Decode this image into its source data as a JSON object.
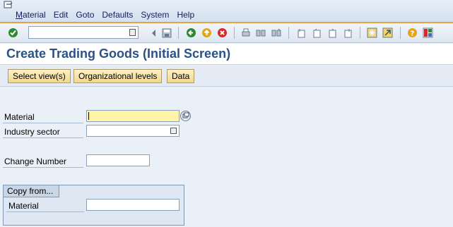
{
  "menu": {
    "items": [
      "Material",
      "Edit",
      "Goto",
      "Defaults",
      "System",
      "Help"
    ]
  },
  "toolbar": {
    "command_field": ""
  },
  "title": "Create Trading Goods (Initial Screen)",
  "app_toolbar": {
    "buttons": [
      "Select view(s)",
      "Organizational levels",
      "Data"
    ]
  },
  "form": {
    "material_label": "Material",
    "material_value": "",
    "industry_label": "Industry sector",
    "industry_value": "",
    "change_label": "Change Number",
    "change_value": ""
  },
  "copy_from": {
    "title": "Copy from...",
    "material_label": "Material",
    "material_value": ""
  },
  "colors": {
    "accent_orange": "#e8a13c",
    "title_blue": "#2a5285",
    "required_yellow": "#fff3a8"
  }
}
